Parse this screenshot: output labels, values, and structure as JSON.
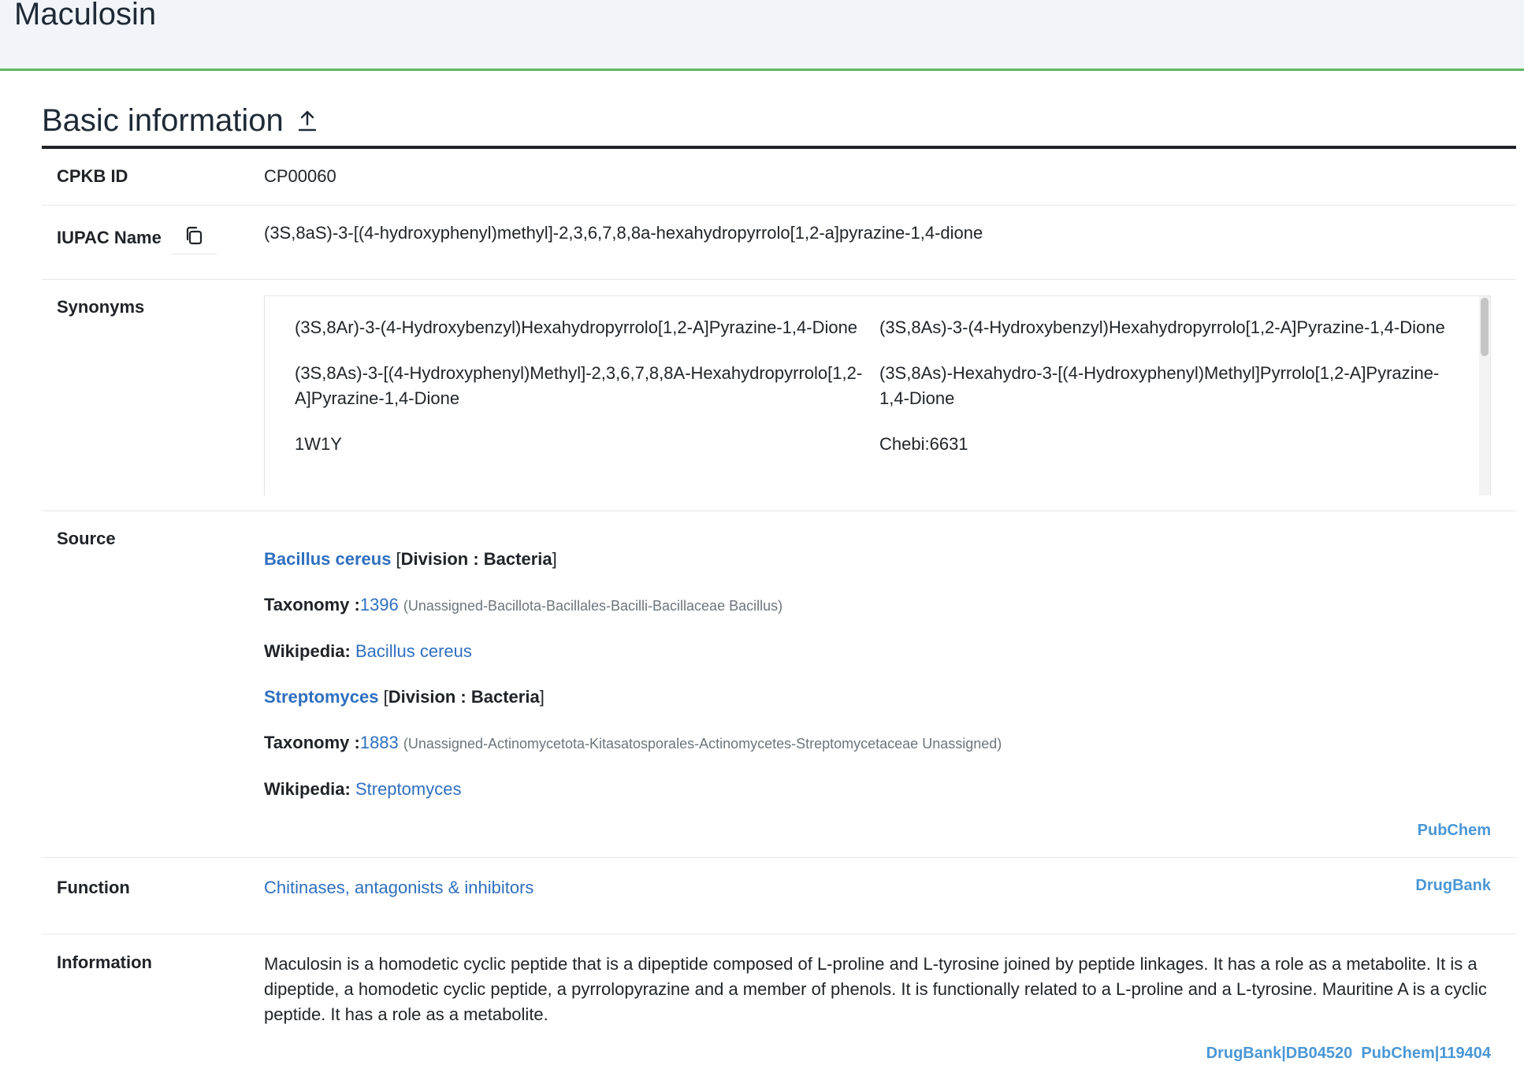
{
  "page": {
    "title": "Maculosin"
  },
  "section": {
    "title": "Basic information"
  },
  "cpkb": {
    "label": "CPKB ID",
    "value": "CP00060"
  },
  "iupac": {
    "label": "IUPAC Name",
    "value": "(3S,8aS)-3-[(4-hydroxyphenyl)methyl]-2,3,6,7,8,8a-hexahydropyrrolo[1,2-a]pyrazine-1,4-dione"
  },
  "synonyms": {
    "label": "Synonyms",
    "items": [
      "(3S,8Ar)-3-(4-Hydroxybenzyl)Hexahydropyrrolo[1,2-A]Pyrazine-1,4-Dione",
      "(3S,8As)-3-(4-Hydroxybenzyl)Hexahydropyrrolo[1,2-A]Pyrazine-1,4-Dione",
      "(3S,8As)-3-[(4-Hydroxyphenyl)Methyl]-2,3,6,7,8,8A-Hexahydropyrrolo[1,2-A]Pyrazine-1,4-Dione",
      "(3S,8As)-Hexahydro-3-[(4-Hydroxyphenyl)Methyl]Pyrrolo[1,2-A]Pyrazine-1,4-Dione",
      "1W1Y",
      "Chebi:6631"
    ]
  },
  "source": {
    "label": "Source",
    "organisms": [
      {
        "name": "Bacillus cereus",
        "division_label": "Division : Bacteria",
        "taxonomy_label": "Taxonomy :",
        "taxonomy_id": "1396",
        "lineage": "(Unassigned-Bacillota-Bacillales-Bacilli-Bacillaceae Bacillus)",
        "wikipedia_label": "Wikipedia:",
        "wikipedia_link": "Bacillus cereus"
      },
      {
        "name": "Streptomyces",
        "division_label": "Division : Bacteria",
        "taxonomy_label": "Taxonomy :",
        "taxonomy_id": "1883",
        "lineage": "(Unassigned-Actinomycetota-Kitasatosporales-Actinomycetes-Streptomycetaceae Unassigned)",
        "wikipedia_label": "Wikipedia:",
        "wikipedia_link": "Streptomyces"
      }
    ],
    "ref": "PubChem"
  },
  "function": {
    "label": "Function",
    "value": "Chitinases, antagonists & inhibitors",
    "ref": "DrugBank"
  },
  "information": {
    "label": "Information",
    "text": "Maculosin is a homodetic cyclic peptide that is a dipeptide composed of L-proline and L-tyrosine joined by peptide linkages. It has a role as a metabolite. It is a dipeptide, a homodetic cyclic peptide, a pyrrolopyrazine and a member of phenols. It is functionally related to a L-proline and a L-tyrosine. Mauritine A is a cyclic peptide. It has a role as a metabolite.",
    "refs": [
      "DrugBank|DB04520",
      "PubChem|119404"
    ]
  },
  "colors": {
    "accent_green": "#5cb85c",
    "link": "#2f6fbf",
    "ref_link": "#4a97d6"
  }
}
